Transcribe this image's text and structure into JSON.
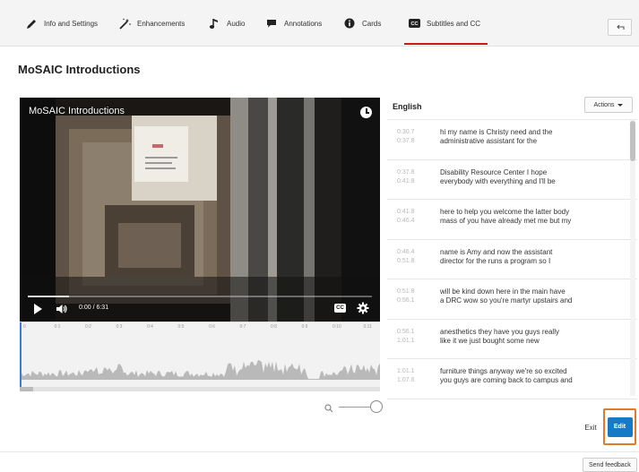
{
  "tabs": [
    {
      "label": "Info and Settings",
      "icon": "pencil-icon"
    },
    {
      "label": "Enhancements",
      "icon": "magic-wand-icon"
    },
    {
      "label": "Audio",
      "icon": "music-note-icon"
    },
    {
      "label": "Annotations",
      "icon": "speech-bubble-icon"
    },
    {
      "label": "Cards",
      "icon": "info-circle-icon"
    },
    {
      "label": "Subtitles and CC",
      "icon": "cc-icon",
      "active": true
    }
  ],
  "back_icon": "back-arrow-icon",
  "page_title": "MoSAIC Introductions",
  "player": {
    "title": "MoSAIC Introductions",
    "time": "0:00 / 6:31",
    "progress": 0.12,
    "cc_label": "CC"
  },
  "timeline": {
    "ruler_labels": [
      "0",
      "0:1",
      "0:2",
      "0:3",
      "0:4",
      "0:5",
      "0:6",
      "0:7",
      "0:8",
      "0:9",
      "0:10",
      "0:11"
    ]
  },
  "captions": {
    "language": "English",
    "actions_label": "Actions",
    "rows": [
      {
        "start": "0:30.7",
        "end": "0:37.8",
        "line1": "hi my name is Christy need and the",
        "line2": "administrative assistant for the"
      },
      {
        "start": "0:37.8",
        "end": "0:41.8",
        "line1": "Disability Resource Center I hope",
        "line2": "everybody with everything and I'll be"
      },
      {
        "start": "0:41.8",
        "end": "0:46.4",
        "line1": "here to help you welcome the latter body",
        "line2": "mass of you have already met me but my"
      },
      {
        "start": "0:46.4",
        "end": "0:51.8",
        "line1": "name is Amy and now the assistant",
        "line2": "director for the runs a program so I"
      },
      {
        "start": "0:51.8",
        "end": "0:56.1",
        "line1": "will be kind down here in the main have",
        "line2": "a DRC wow so you're martyr upstairs and"
      },
      {
        "start": "0:56.1",
        "end": "1:01.1",
        "line1": "anesthetics they have you guys really",
        "line2": "like it we just bought some new"
      },
      {
        "start": "1:01.1",
        "end": "1:07.6",
        "line1": "furniture things anyway we're so excited",
        "line2": "you guys are coming back to campus and"
      }
    ]
  },
  "buttons": {
    "exit": "Exit",
    "edit": "Edit",
    "send_feedback": "Send feedback"
  },
  "colors": {
    "active_tab_underline": "#cc1a1a",
    "edit_button": "#167ac6",
    "highlight_border": "#e07b2a",
    "playhead": "#3b7bd4"
  }
}
